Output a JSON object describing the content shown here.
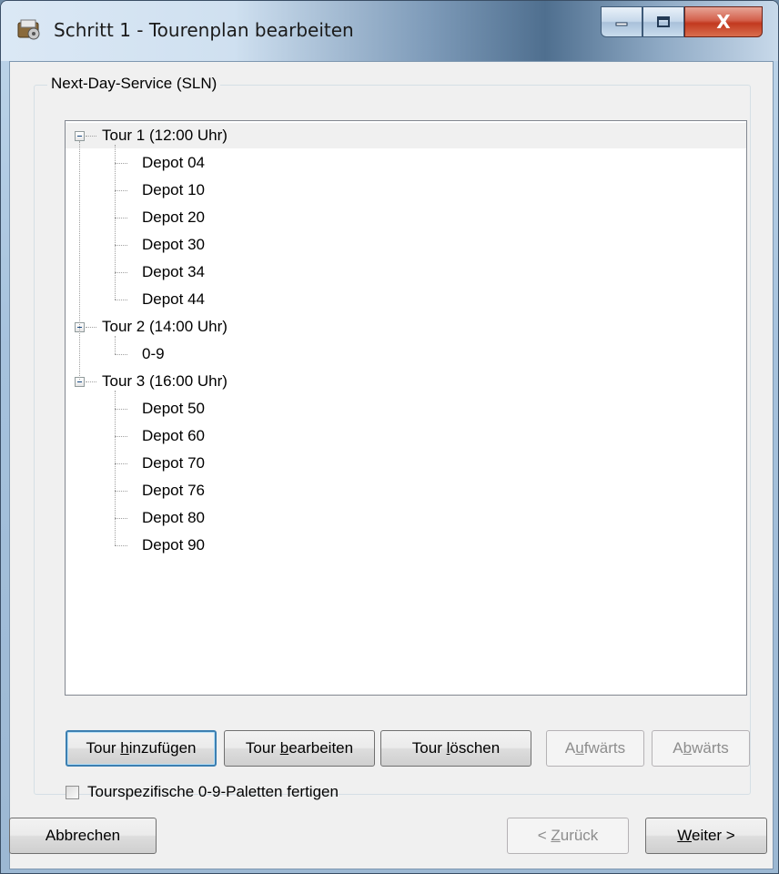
{
  "window": {
    "title": "Schritt 1 - Tourenplan bearbeiten",
    "close_glyph": "X"
  },
  "group": {
    "label": "Next-Day-Service (SLN)"
  },
  "tree": {
    "tours": [
      {
        "label": "Tour 1 (12:00 Uhr)",
        "children": [
          "Depot 04",
          "Depot 10",
          "Depot 20",
          "Depot 30",
          "Depot 34",
          "Depot 44"
        ]
      },
      {
        "label": "Tour 2 (14:00 Uhr)",
        "children": [
          "0-9"
        ]
      },
      {
        "label": "Tour 3 (16:00 Uhr)",
        "children": [
          "Depot 50",
          "Depot 60",
          "Depot 70",
          "Depot 76",
          "Depot 80",
          "Depot 90"
        ]
      }
    ]
  },
  "buttons": {
    "add": {
      "pre": "Tour ",
      "accel": "h",
      "post": "inzufügen"
    },
    "edit": {
      "pre": "Tour ",
      "accel": "b",
      "post": "earbeiten"
    },
    "delete": {
      "pre": "Tour ",
      "accel": "l",
      "post": "öschen"
    },
    "up": {
      "pre": "A",
      "accel": "u",
      "post": "fwärts"
    },
    "down": {
      "pre": "A",
      "accel": "b",
      "post": "wärts"
    },
    "cancel": {
      "label": "Abbrechen"
    },
    "back": {
      "pre": "< ",
      "accel": "Z",
      "post": "urück"
    },
    "next": {
      "pre": "",
      "accel": "W",
      "post": "eiter >"
    }
  },
  "checkbox": {
    "label": "Tourspezifische 0-9-Paletten fertigen",
    "checked": false
  }
}
